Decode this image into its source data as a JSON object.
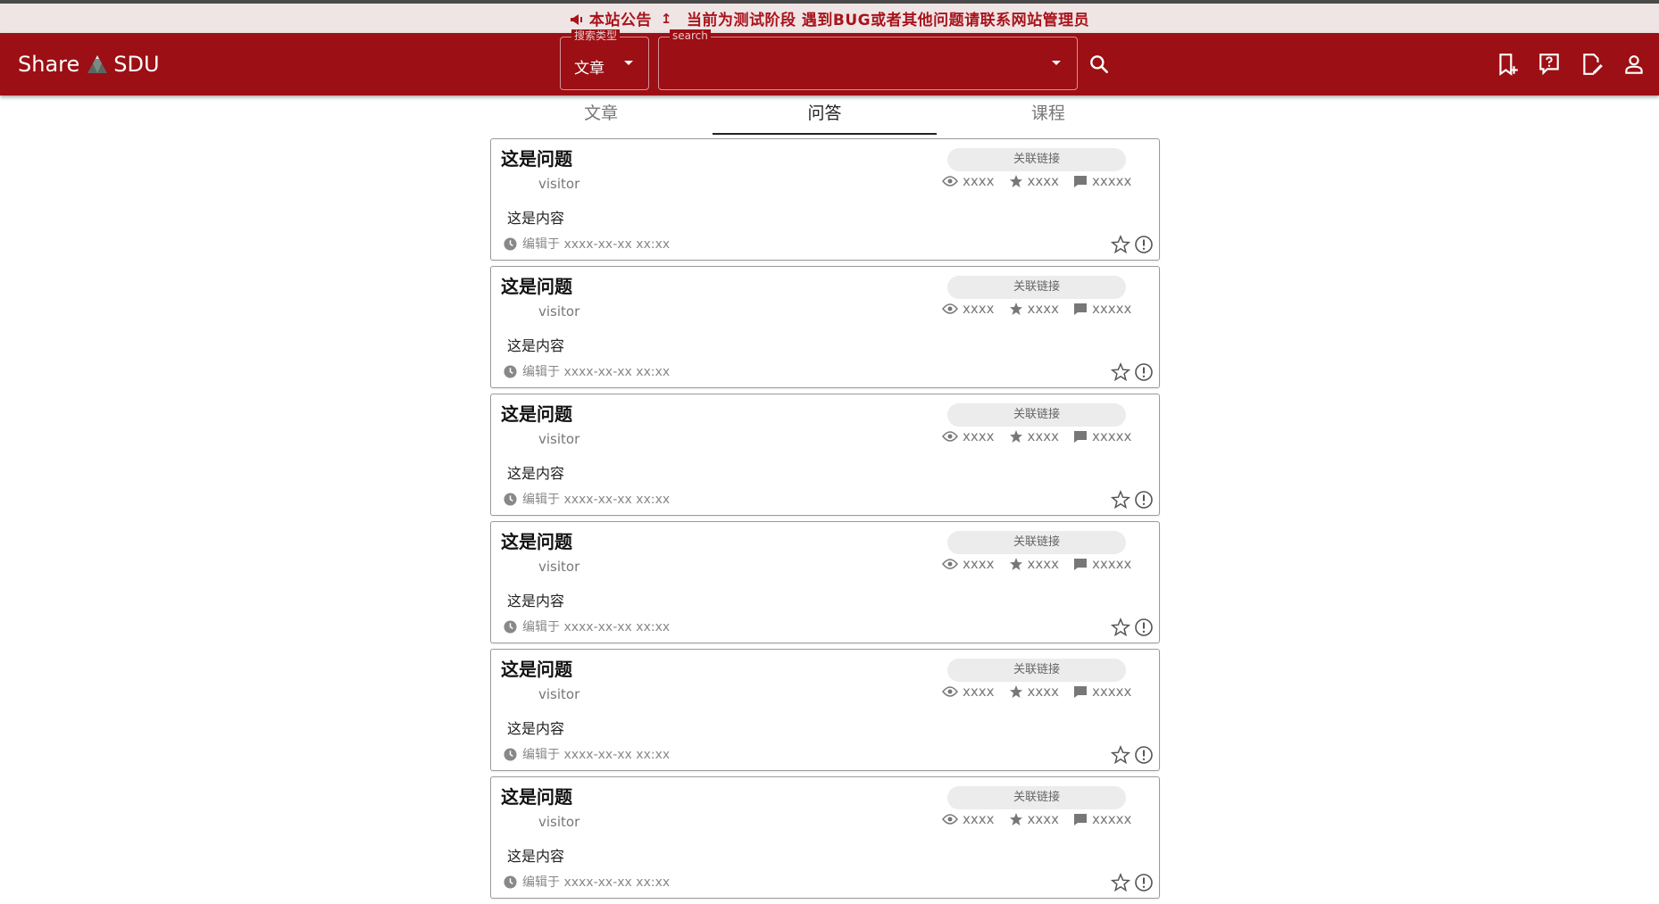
{
  "announcement": {
    "title": "本站公告",
    "arrow": "↥",
    "message": "当前为测试阶段 遇到BUG或者其他问题请联系网站管理员"
  },
  "header": {
    "brand_left": "Share",
    "brand_right": "SDU",
    "search_type": {
      "label": "搜索类型",
      "value": "文章"
    },
    "search": {
      "label": "search",
      "value": ""
    },
    "icons": [
      "bookmark-add-icon",
      "question-icon",
      "edit-note-icon",
      "person-icon"
    ]
  },
  "tabs": [
    {
      "label": "文章",
      "active": false
    },
    {
      "label": "问答",
      "active": true
    },
    {
      "label": "课程",
      "active": false
    }
  ],
  "questions": [
    {
      "title": "这是问题",
      "user": "visitor",
      "content": "这是内容",
      "time": "编辑于 xxxx-xx-xx xx:xx",
      "link": "关联链接",
      "views": "xxxx",
      "stars": "xxxx",
      "comments": "xxxxx"
    },
    {
      "title": "这是问题",
      "user": "visitor",
      "content": "这是内容",
      "time": "编辑于 xxxx-xx-xx xx:xx",
      "link": "关联链接",
      "views": "xxxx",
      "stars": "xxxx",
      "comments": "xxxxx"
    },
    {
      "title": "这是问题",
      "user": "visitor",
      "content": "这是内容",
      "time": "编辑于 xxxx-xx-xx xx:xx",
      "link": "关联链接",
      "views": "xxxx",
      "stars": "xxxx",
      "comments": "xxxxx"
    },
    {
      "title": "这是问题",
      "user": "visitor",
      "content": "这是内容",
      "time": "编辑于 xxxx-xx-xx xx:xx",
      "link": "关联链接",
      "views": "xxxx",
      "stars": "xxxx",
      "comments": "xxxxx"
    },
    {
      "title": "这是问题",
      "user": "visitor",
      "content": "这是内容",
      "time": "编辑于 xxxx-xx-xx xx:xx",
      "link": "关联链接",
      "views": "xxxx",
      "stars": "xxxx",
      "comments": "xxxxx"
    },
    {
      "title": "这是问题",
      "user": "visitor",
      "content": "这是内容",
      "time": "编辑于 xxxx-xx-xx xx:xx",
      "link": "关联链接",
      "views": "xxxx",
      "stars": "xxxx",
      "comments": "xxxxx"
    }
  ],
  "colors": {
    "primary": "#9c0f14",
    "announce_bg": "#f0e5e5",
    "announce_text": "#a8141c"
  }
}
